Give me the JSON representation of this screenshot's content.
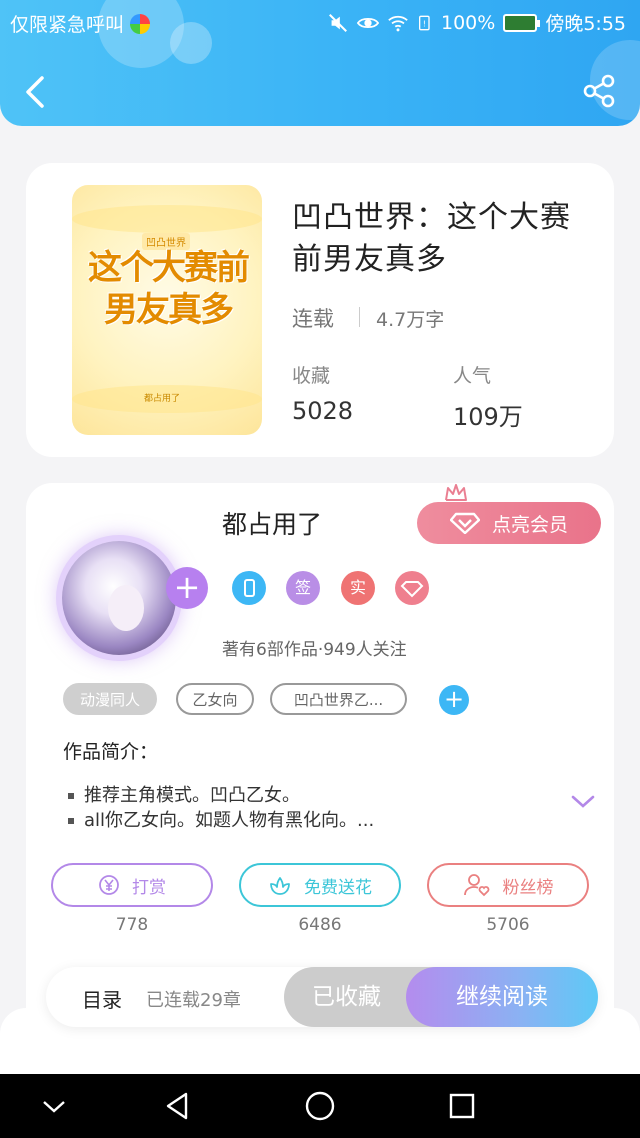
{
  "status_bar": {
    "left_text": "仅限紧急呼叫",
    "battery_percent": "100%",
    "time": "傍晚5:55",
    "icons": [
      "mute-icon",
      "eye-icon",
      "wifi-icon",
      "sim-icon",
      "battery-icon"
    ]
  },
  "header": {
    "back_icon": "chevron-left-icon",
    "share_icon": "share-icon"
  },
  "book": {
    "title": "凹凸世界：这个大赛前男友真多",
    "status": "连载",
    "word_count": "4.7万字",
    "favorites_label": "收藏",
    "favorites_value": "5028",
    "popularity_label": "人气",
    "popularity_value": "109万",
    "cover": {
      "series_tag": "凹凸世界",
      "title": "这个大赛前男友真多",
      "author": "都占用了"
    }
  },
  "author": {
    "name": "都占用了",
    "vip_button": "点亮会员",
    "badges": [
      {
        "icon": "phone-icon",
        "color": "#3db7f5"
      },
      {
        "text": "签",
        "color": "#b98ee6"
      },
      {
        "text": "实",
        "color": "#ef7373"
      },
      {
        "icon": "diamond-icon",
        "color": "#ef7f8e"
      }
    ],
    "meta": "著有6部作品·949人关注",
    "tags": [
      "动漫同人",
      "乙女向",
      "凹凸世界乙..."
    ],
    "intro_label": "作品简介：",
    "intro_lines": [
      "推荐主角模式。凹凸乙女。",
      "all你乙女向。如题人物有黑化向。..."
    ]
  },
  "actions": [
    {
      "label": "打赏",
      "count": "778",
      "icon": "yen-coin-icon",
      "color": "#b388e8"
    },
    {
      "label": "免费送花",
      "count": "6486",
      "icon": "flower-icon",
      "color": "#3cc6d8"
    },
    {
      "label": "粉丝榜",
      "count": "5706",
      "icon": "fan-user-icon",
      "color": "#ea8080"
    }
  ],
  "bottom_bar": {
    "toc_label": "目录",
    "chapter_count": "已连载29章",
    "collected_label": "已收藏",
    "continue_label": "继续阅读"
  },
  "nav": [
    "collapse-icon",
    "back-triangle-icon",
    "home-circle-icon",
    "recents-square-icon"
  ]
}
